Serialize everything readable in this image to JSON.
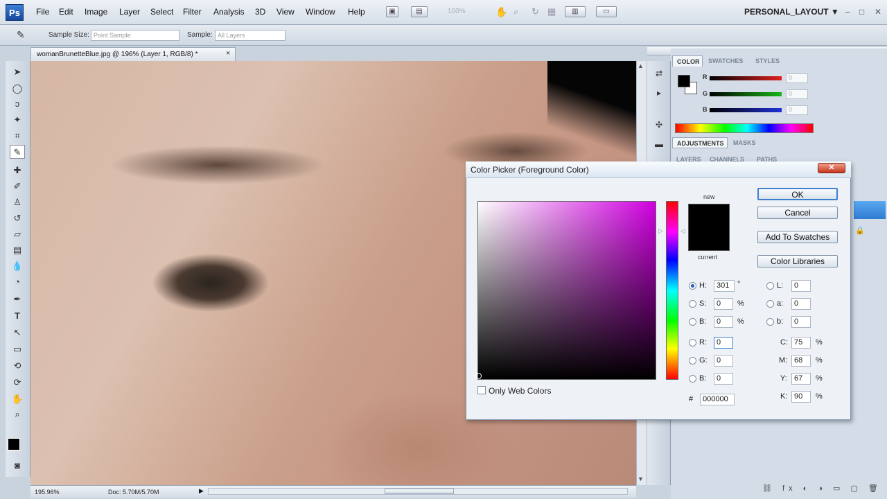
{
  "app": {
    "logo": "Ps"
  },
  "menu": [
    "File",
    "Edit",
    "Image",
    "Layer",
    "Select",
    "Filter",
    "Analysis",
    "3D",
    "View",
    "Window",
    "Help"
  ],
  "toolbar": {
    "zoom": "100%",
    "workspace": "PERSONAL_LAYOUT",
    "workspace_arrow": "▼"
  },
  "window_controls": {
    "min": "–",
    "max": "□",
    "close": "✕"
  },
  "options": {
    "sample_size_label": "Sample Size:",
    "sample_size_value": "Point Sample",
    "sample_label": "Sample:",
    "sample_value": "All Layers"
  },
  "document": {
    "tab_title": "womanBrunetteBlue.jpg @ 196% (Layer 1, RGB/8) *",
    "close": "×"
  },
  "status": {
    "zoom": "195.96%",
    "doc": "Doc: 5.70M/5.70M"
  },
  "panels": {
    "color_tab": "COLOR",
    "swatches_tab": "SWATCHES",
    "styles_tab": "STYLES",
    "sliders": [
      {
        "label": "R",
        "value": "0",
        "color": "#e02020"
      },
      {
        "label": "G",
        "value": "0",
        "color": "#18b418"
      },
      {
        "label": "B",
        "value": "0",
        "color": "#2030d8"
      }
    ],
    "adjustments_tab": "ADJUSTMENTS",
    "masks_tab": "MASKS",
    "layers_tab": "LAYERS",
    "channels_tab": "CHANNELS",
    "paths_tab": "PATHS"
  },
  "dialog": {
    "title": "Color Picker (Foreground Color)",
    "close": "✕",
    "new_label": "new",
    "current_label": "current",
    "ok": "OK",
    "cancel": "Cancel",
    "add_to_swatches": "Add To Swatches",
    "color_libraries": "Color Libraries",
    "only_web_colors": "Only Web Colors",
    "hsb": [
      {
        "label": "H:",
        "value": "301",
        "unit": "°"
      },
      {
        "label": "S:",
        "value": "0",
        "unit": "%"
      },
      {
        "label": "B:",
        "value": "0",
        "unit": "%"
      }
    ],
    "rgb": [
      {
        "label": "R:",
        "value": "0"
      },
      {
        "label": "G:",
        "value": "0"
      },
      {
        "label": "B:",
        "value": "0"
      }
    ],
    "lab": [
      {
        "label": "L:",
        "value": "0"
      },
      {
        "label": "a:",
        "value": "0"
      },
      {
        "label": "b:",
        "value": "0"
      }
    ],
    "cmyk": [
      {
        "label": "C:",
        "value": "75",
        "unit": "%"
      },
      {
        "label": "M:",
        "value": "68",
        "unit": "%"
      },
      {
        "label": "Y:",
        "value": "67",
        "unit": "%"
      },
      {
        "label": "K:",
        "value": "90",
        "unit": "%"
      }
    ],
    "hex_label": "#",
    "hex": "000000"
  }
}
